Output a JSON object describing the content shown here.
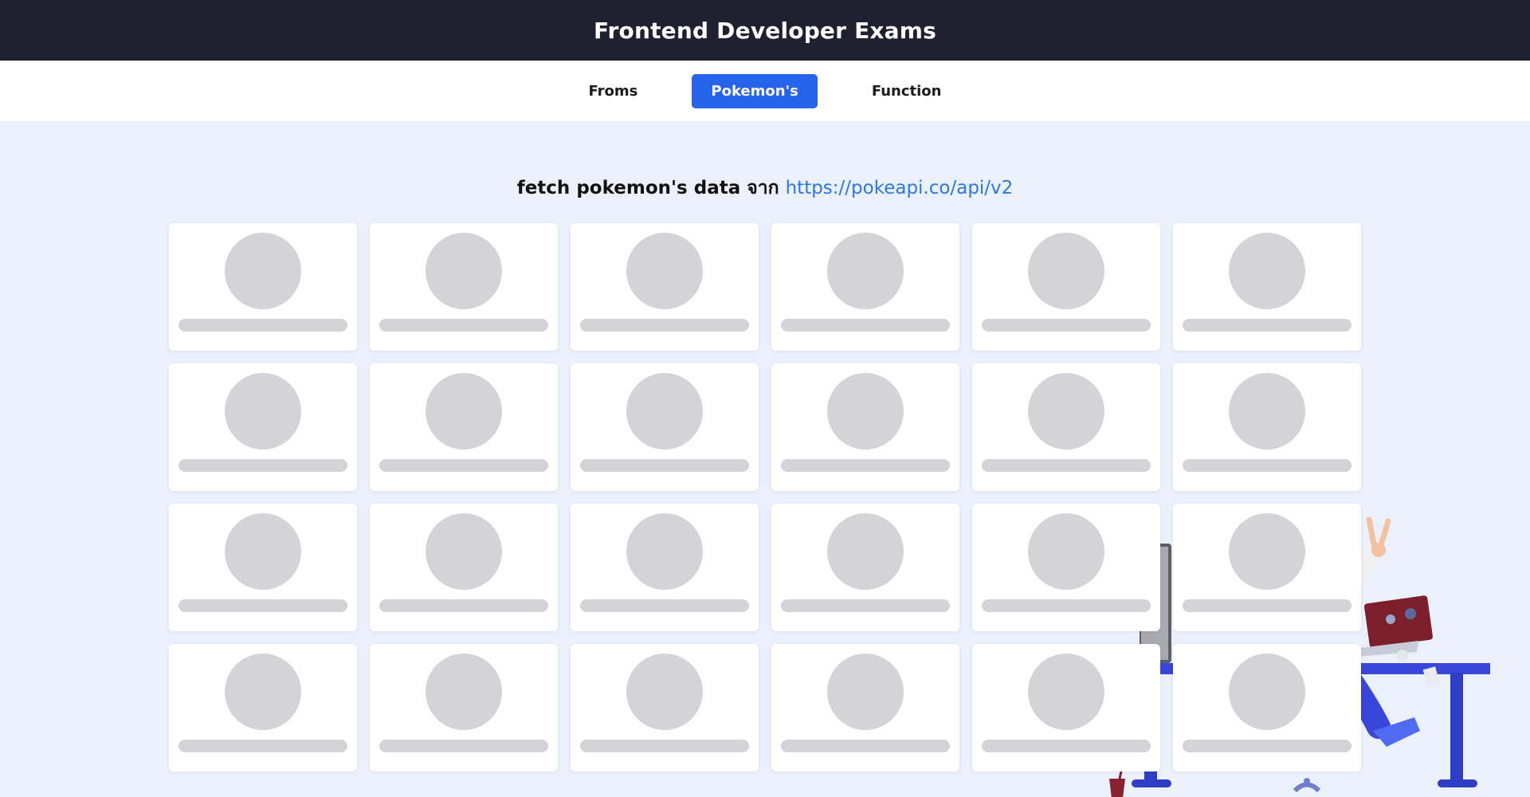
{
  "header": {
    "title": "Frontend Developer Exams"
  },
  "tabs": [
    {
      "label": "Froms",
      "active": false
    },
    {
      "label": "Pokemon's",
      "active": true
    },
    {
      "label": "Function",
      "active": false
    }
  ],
  "content": {
    "subtitle_prefix": "fetch pokemon's data จาก",
    "link_text": "https://pokeapi.co/api/v2"
  },
  "grid": {
    "columns": 6,
    "rows": 4,
    "loading_cards": 24
  },
  "colors": {
    "header_bg": "#1f2030",
    "page_bg": "#ebf1fc",
    "accent": "#2563eb",
    "link": "#2d76e6",
    "skeleton": "#d4d4d8"
  },
  "icons": {
    "decoration": "developer-desk-illustration"
  }
}
